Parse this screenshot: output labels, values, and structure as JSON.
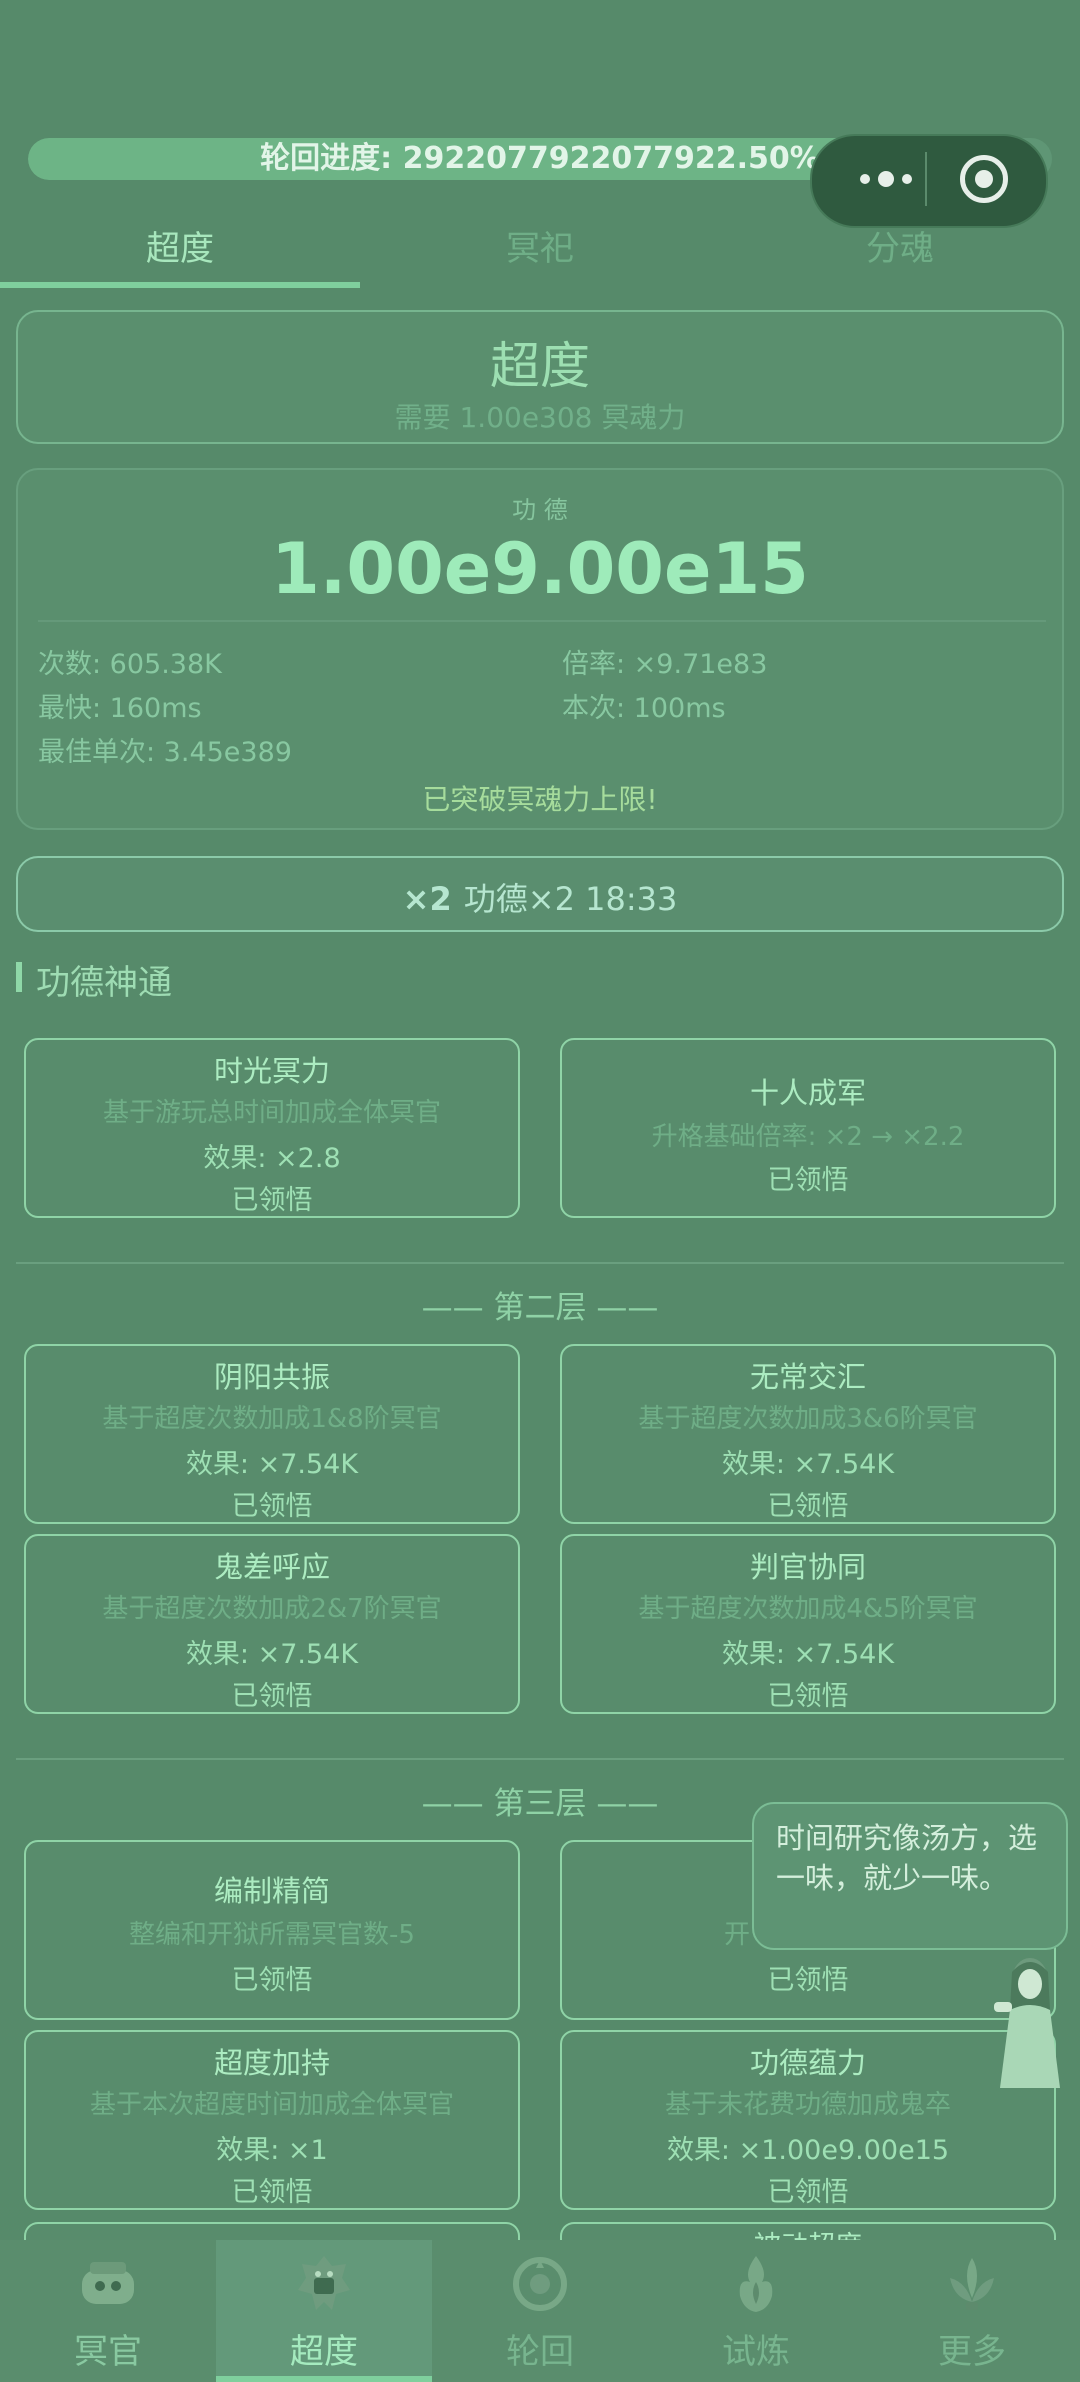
{
  "progress": {
    "label": "轮回进度: 2922077922077922.50%",
    "fill_fraction": 0.97
  },
  "tabs": [
    {
      "label": "超度",
      "active": true
    },
    {
      "label": "冥祀",
      "active": false
    },
    {
      "label": "分魂",
      "active": false
    }
  ],
  "chaodu_panel": {
    "title": "超度",
    "requirement": "需要 1.00e308 冥魂力"
  },
  "merit": {
    "label": "功 德",
    "value": "1.00e9.00e15",
    "stats": {
      "count": "次数: 605.38K",
      "rate": "倍率: ×9.71e83",
      "fastest": "最快: 160ms",
      "current": "本次: 100ms",
      "best": "最佳单次: 3.45e389"
    },
    "notice": "已突破冥魂力上限!"
  },
  "boost": {
    "badge": "×2",
    "text": "功德×2 18:33"
  },
  "section_title": "功德神通",
  "layer1": [
    {
      "title": "时光冥力",
      "desc": "基于游玩总时间加成全体冥官",
      "effect": "效果: ×2.8",
      "status": "已领悟"
    },
    {
      "title": "十人成军",
      "desc": "升格基础倍率: ×2 → ×2.2",
      "status": "已领悟"
    }
  ],
  "layer2": {
    "title": "—— 第二层 ——",
    "items": [
      {
        "title": "阴阳共振",
        "desc": "基于超度次数加成1&8阶冥官",
        "effect": "效果: ×7.54K",
        "status": "已领悟"
      },
      {
        "title": "无常交汇",
        "desc": "基于超度次数加成3&6阶冥官",
        "effect": "效果: ×7.54K",
        "status": "已领悟"
      },
      {
        "title": "鬼差呼应",
        "desc": "基于超度次数加成2&7阶冥官",
        "effect": "效果: ×7.54K",
        "status": "已领悟"
      },
      {
        "title": "判官协同",
        "desc": "基于超度次数加成4&5阶冥官",
        "effect": "效果: ×7.54K",
        "status": "已领悟"
      }
    ]
  },
  "layer3": {
    "title": "—— 第三层 ——",
    "items": [
      {
        "title": "编制精简",
        "desc": "整编和开狱所需冥官数-5",
        "status": "已领悟"
      },
      {
        "title": "",
        "desc": "开",
        "status": "已领悟"
      },
      {
        "title": "超度加持",
        "desc": "基于本次超度时间加成全体冥官",
        "effect": "效果: ×1",
        "status": "已领悟"
      },
      {
        "title": "功德蕴力",
        "desc": "基于未花费功德加成鬼卒",
        "effect": "效果: ×1.00e9.00e15",
        "status": "已领悟"
      }
    ],
    "partial_next": "被动超度"
  },
  "speech_bubble": "时间研究像汤方，选一味，就少一味。",
  "bottom_nav": [
    {
      "label": "冥官",
      "icon": "ghost-official-icon"
    },
    {
      "label": "超度",
      "icon": "demon-mask-icon",
      "active": true
    },
    {
      "label": "轮回",
      "icon": "reincarnation-icon"
    },
    {
      "label": "试炼",
      "icon": "flame-trial-icon"
    },
    {
      "label": "更多",
      "icon": "lotus-more-icon"
    }
  ],
  "colors": {
    "background": "#568a6a",
    "accent": "#7fcf9d",
    "text": "#a8e7bd"
  }
}
